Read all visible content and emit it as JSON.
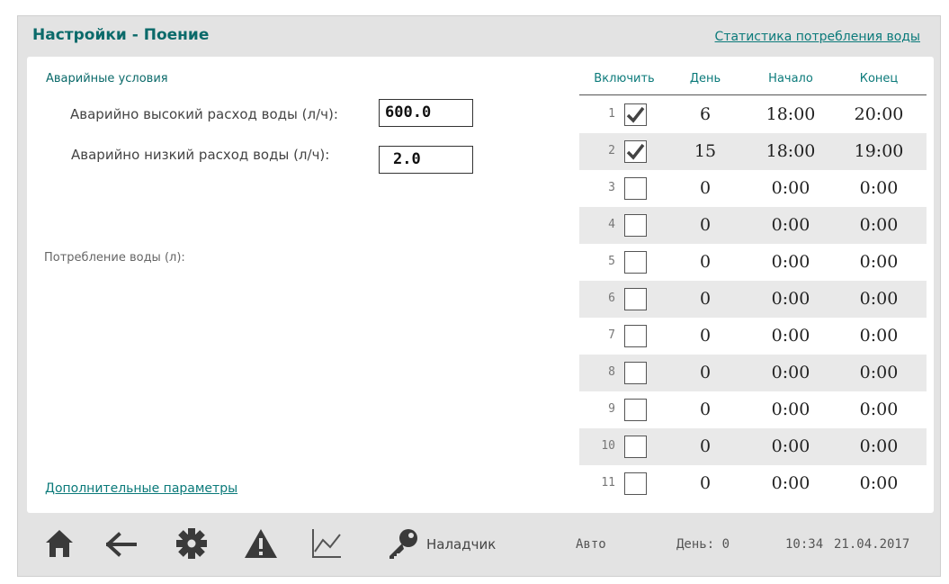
{
  "header": {
    "title": "Настройки - Поение",
    "stats_link": "Статистика потребления воды"
  },
  "alarms": {
    "heading": "Аварийные условия",
    "high_label": "Аварийно высокий расход воды (л/ч):",
    "high_value": "600.0",
    "low_label": "Аварийно низкий расход воды (л/ч):",
    "low_value": "2.0"
  },
  "consumption_label": "Потребление воды (л):",
  "extra_link": "Дополнительные параметры",
  "schedule": {
    "columns": [
      "Включить",
      "День",
      "Начало",
      "Конец"
    ],
    "rows": [
      {
        "index": "1",
        "enabled": true,
        "day": "6",
        "start": "18:00",
        "end": "20:00"
      },
      {
        "index": "2",
        "enabled": true,
        "day": "15",
        "start": "18:00",
        "end": "19:00"
      },
      {
        "index": "3",
        "enabled": false,
        "day": "0",
        "start": "0:00",
        "end": "0:00"
      },
      {
        "index": "4",
        "enabled": false,
        "day": "0",
        "start": "0:00",
        "end": "0:00"
      },
      {
        "index": "5",
        "enabled": false,
        "day": "0",
        "start": "0:00",
        "end": "0:00"
      },
      {
        "index": "6",
        "enabled": false,
        "day": "0",
        "start": "0:00",
        "end": "0:00"
      },
      {
        "index": "7",
        "enabled": false,
        "day": "0",
        "start": "0:00",
        "end": "0:00"
      },
      {
        "index": "8",
        "enabled": false,
        "day": "0",
        "start": "0:00",
        "end": "0:00"
      },
      {
        "index": "9",
        "enabled": false,
        "day": "0",
        "start": "0:00",
        "end": "0:00"
      },
      {
        "index": "10",
        "enabled": false,
        "day": "0",
        "start": "0:00",
        "end": "0:00"
      },
      {
        "index": "11",
        "enabled": false,
        "day": "0",
        "start": "0:00",
        "end": "0:00"
      }
    ]
  },
  "footer": {
    "icons": [
      "home-icon",
      "back-arrow-icon",
      "gear-icon",
      "warning-icon",
      "chart-icon",
      "key-icon"
    ],
    "user": "Наладчик",
    "mode": "Авто",
    "day": "День: 0",
    "time": "10:34",
    "date": "21.04.2017"
  },
  "colors": {
    "accent": "#0b7a7a",
    "frame": "#e3e3e3",
    "row_shade": "#e9e9e9",
    "icon": "#3a3a3a"
  }
}
